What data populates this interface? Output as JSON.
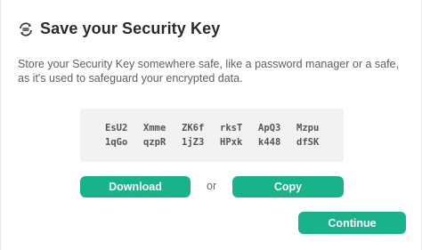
{
  "dialog": {
    "title": "Save your Security Key",
    "description": "Store your Security Key somewhere safe, like a password manager or a safe, as it's used to safeguard your encrypted data.",
    "icon": "key-sync-icon"
  },
  "security_key": {
    "rows": [
      [
        "EsU2",
        "Xmme",
        "ZK6f",
        "rksT",
        "ApQ3",
        "Mzpu"
      ],
      [
        "1qGo",
        "qzpR",
        "1jZ3",
        "HPxk",
        "k448",
        "dfSK"
      ]
    ]
  },
  "actions": {
    "download_label": "Download",
    "or_label": "or",
    "copy_label": "Copy",
    "continue_label": "Continue"
  },
  "colors": {
    "accent": "#18b38a",
    "key_background": "#f2f2f2"
  }
}
